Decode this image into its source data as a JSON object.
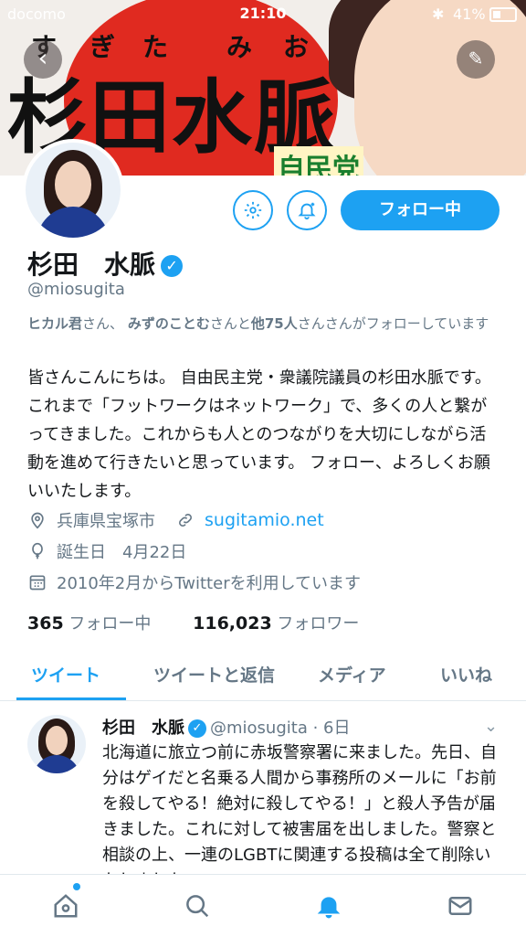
{
  "status_bar": {
    "carrier": "docomo",
    "time": "21:10",
    "battery": "41%"
  },
  "banner": {
    "name_large": "杉田水脈",
    "ruby": [
      "す",
      "ぎ",
      "た",
      "み",
      "お"
    ],
    "party": "自民党"
  },
  "profile": {
    "name": "杉田　水脈",
    "handle": "@miosugita",
    "follow_button": "フォロー中",
    "followed_by": {
      "user1": "ヒカル君",
      "mid1": "さん、",
      "user2": "みずのことむ",
      "mid2": "さんと",
      "others": "他75人",
      "tail": "さんさんがフォローしています"
    },
    "bio": "皆さんこんにちは。 自由民主党・衆議院議員の杉田水脈です。 これまで「フットワークはネットワーク」で、多くの人と繋がってきました。これからも人とのつながりを大切にしながら活動を進めて行きたいと思っています。 フォロー、よろしくお願いいたします。",
    "location": "兵庫県宝塚市",
    "website": "sugitamio.net",
    "birthday": "誕生日　4月22日",
    "joined": "2010年2月からTwitterを利用しています",
    "following_count": "365",
    "following_label": "フォロー中",
    "followers_count": "116,023",
    "followers_label": "フォロワー"
  },
  "tabs": [
    "ツイート",
    "ツイートと返信",
    "メディア",
    "いいね"
  ],
  "tweet": {
    "name": "杉田　水脈",
    "handle_time": "@miosugita · 6日",
    "text": "北海道に旅立つ前に赤坂警察署に来ました。先日、自分はゲイだと名乗る人間から事務所のメールに「お前を殺してやる！絶対に殺してやる！」と殺人予告が届きました。これに対して被害届を出しました。警察と相談の上、一連のLGBTに関連する投稿は全て削除いたしました。"
  },
  "colors": {
    "accent": "#1da1f2",
    "muted": "#657786"
  },
  "icons": [
    "back-arrow-icon",
    "compose-icon",
    "settings-gear-icon",
    "notification-bell-icon",
    "location-pin-icon",
    "link-icon",
    "balloon-icon",
    "calendar-icon",
    "home-icon",
    "search-icon",
    "notifications-icon",
    "messages-icon"
  ]
}
